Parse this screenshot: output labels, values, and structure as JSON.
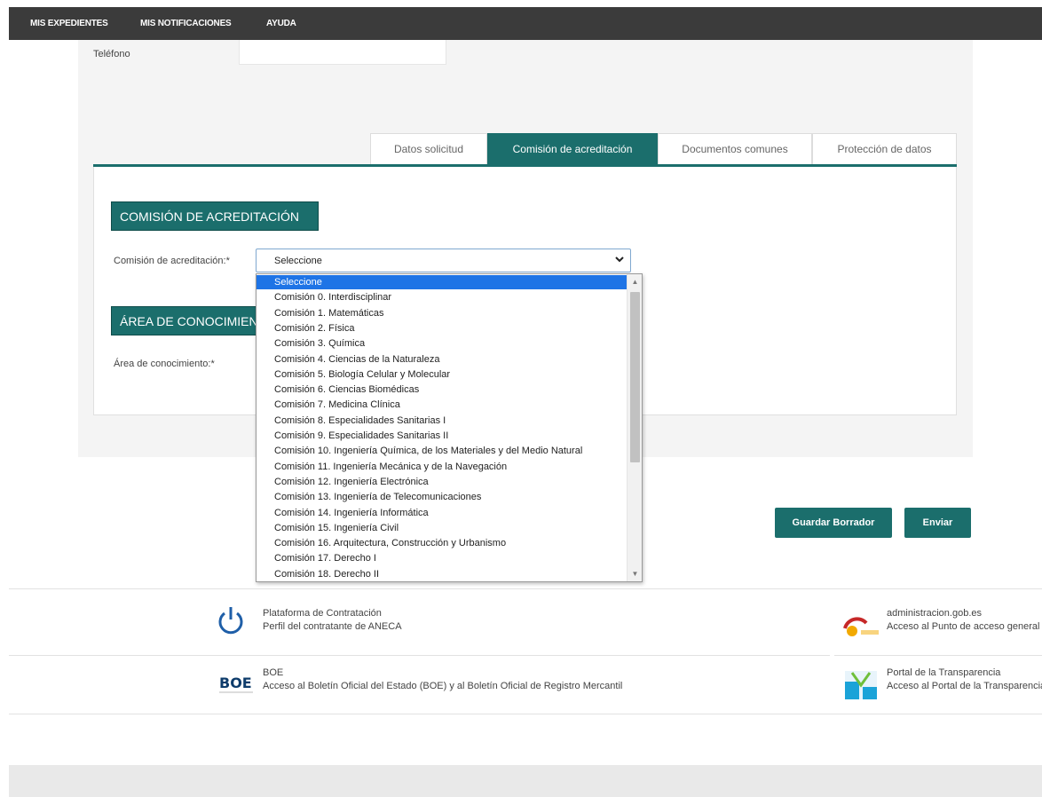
{
  "nav": {
    "items": [
      "MIS EXPEDIENTES",
      "MIS NOTIFICACIONES",
      "AYUDA"
    ]
  },
  "form": {
    "telefono_label": "Teléfono",
    "telefono_value": ""
  },
  "tabs": [
    {
      "label": "Datos solicitud",
      "active": false
    },
    {
      "label": "Comisión de acreditación",
      "active": true
    },
    {
      "label": "Documentos comunes",
      "active": false
    },
    {
      "label": "Protección de datos",
      "active": false
    }
  ],
  "section_comision": {
    "heading": "COMISIÓN DE ACREDITACIÓN",
    "label": "Comisión de acreditación:*",
    "selected": "Seleccione"
  },
  "section_area": {
    "heading": "ÁREA DE CONOCIMIENTO",
    "label": "Área de conocimiento:*"
  },
  "dropdown": {
    "options": [
      "Seleccione",
      "Comisión 0. Interdisciplinar",
      "Comisión 1. Matemáticas",
      "Comisión 2. Física",
      "Comisión 3. Química",
      "Comisión 4. Ciencias de la Naturaleza",
      "Comisión 5. Biología Celular y Molecular",
      "Comisión 6. Ciencias Biomédicas",
      "Comisión 7. Medicina Clínica",
      "Comisión 8. Especialidades Sanitarias I",
      "Comisión 9. Especialidades Sanitarias II",
      "Comisión 10. Ingeniería Química, de los Materiales y del Medio Natural",
      "Comisión 11. Ingeniería Mecánica y de la Navegación",
      "Comisión 12. Ingeniería Electrónica",
      "Comisión 13. Ingeniería de Telecomunicaciones",
      "Comisión 14. Ingeniería Informática",
      "Comisión 15. Ingeniería Civil",
      "Comisión 16. Arquitectura, Construcción y Urbanismo",
      "Comisión 17. Derecho I",
      "Comisión 18. Derecho II"
    ],
    "highlighted_index": 0
  },
  "buttons": {
    "save_draft": "Guardar Borrador",
    "send": "Enviar"
  },
  "footer": {
    "plataforma_title": "Plataforma de Contratación",
    "plataforma_desc": "Perfil del contratante de ANECA",
    "admin_title": "administracion.gob.es",
    "admin_desc": "Acceso al Punto de acceso general",
    "boe_title": "BOE",
    "boe_desc": "Acceso al Boletín Oficial del Estado (BOE) y al Boletín Oficial de Registro Mercantil",
    "transparencia_title": "Portal de la Transparencia",
    "transparencia_desc": "Acceso al Portal de la Transparencia",
    "boe_logo_text": "BOE"
  },
  "colors": {
    "brand": "#1b6e6c",
    "nav_bg": "#3b3b3b",
    "highlight": "#1e74e6"
  }
}
